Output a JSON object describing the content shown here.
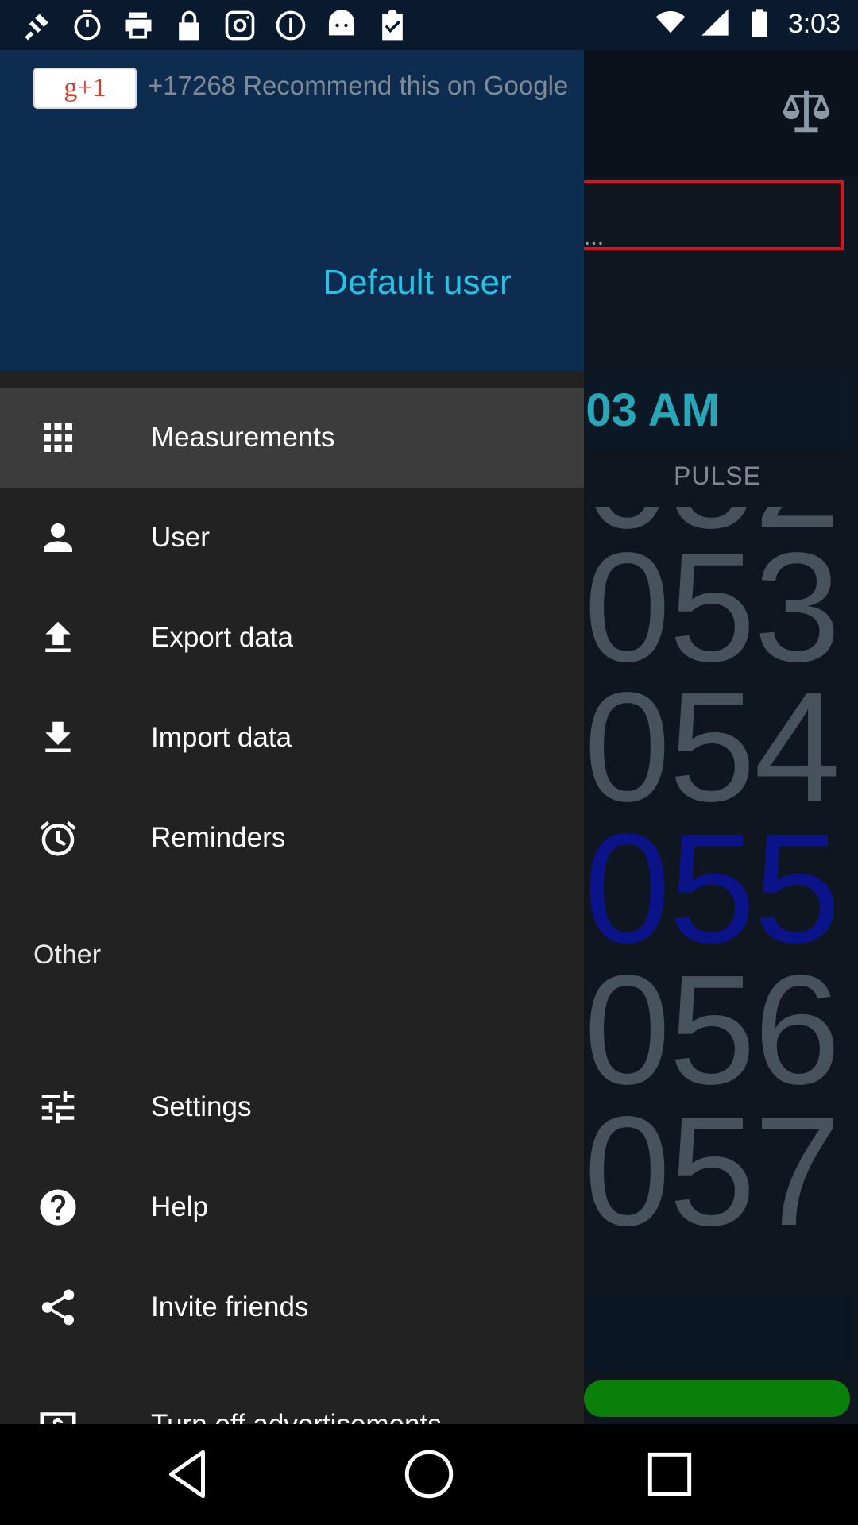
{
  "status_bar": {
    "time": "3:03",
    "left_icons": [
      "satellite-icon",
      "timer-icon",
      "print-icon",
      "lock-icon",
      "instagram-icon",
      "info-icon",
      "android-icon",
      "clipboard-check-icon"
    ],
    "right_icons": [
      "wifi-icon",
      "signal-icon",
      "battery-icon"
    ]
  },
  "background_app": {
    "time_display": ":03 AM",
    "pulse_label": "PULSE",
    "roller_values": [
      "053",
      "054",
      "055",
      "056",
      "057"
    ],
    "selected_value": "055",
    "ellipsis": "...",
    "colors": {
      "accent": "#28a7b9",
      "selected": "#0a1488",
      "frame": "#e0101c",
      "green_bar": "#0a7f0a"
    }
  },
  "drawer": {
    "header": {
      "gplus_label": "g+1",
      "recommend_text": "+17268 Recommend this on Google",
      "user_name": "Default user"
    },
    "items": [
      {
        "label": "Measurements",
        "icon": "grid-icon"
      },
      {
        "label": "User",
        "icon": "person-icon"
      },
      {
        "label": "Export data",
        "icon": "upload-icon"
      },
      {
        "label": "Import data",
        "icon": "download-icon"
      },
      {
        "label": "Reminders",
        "icon": "alarm-icon"
      }
    ],
    "section_other": "Other",
    "other_items": [
      {
        "label": "Settings",
        "icon": "sliders-icon"
      },
      {
        "label": "Help",
        "icon": "help-icon"
      },
      {
        "label": "Invite friends",
        "icon": "share-icon"
      },
      {
        "label": "Turn off advertisements",
        "icon": "money-icon"
      }
    ]
  },
  "nav_bar": {
    "buttons": [
      "back-icon",
      "home-icon",
      "recents-icon"
    ]
  }
}
